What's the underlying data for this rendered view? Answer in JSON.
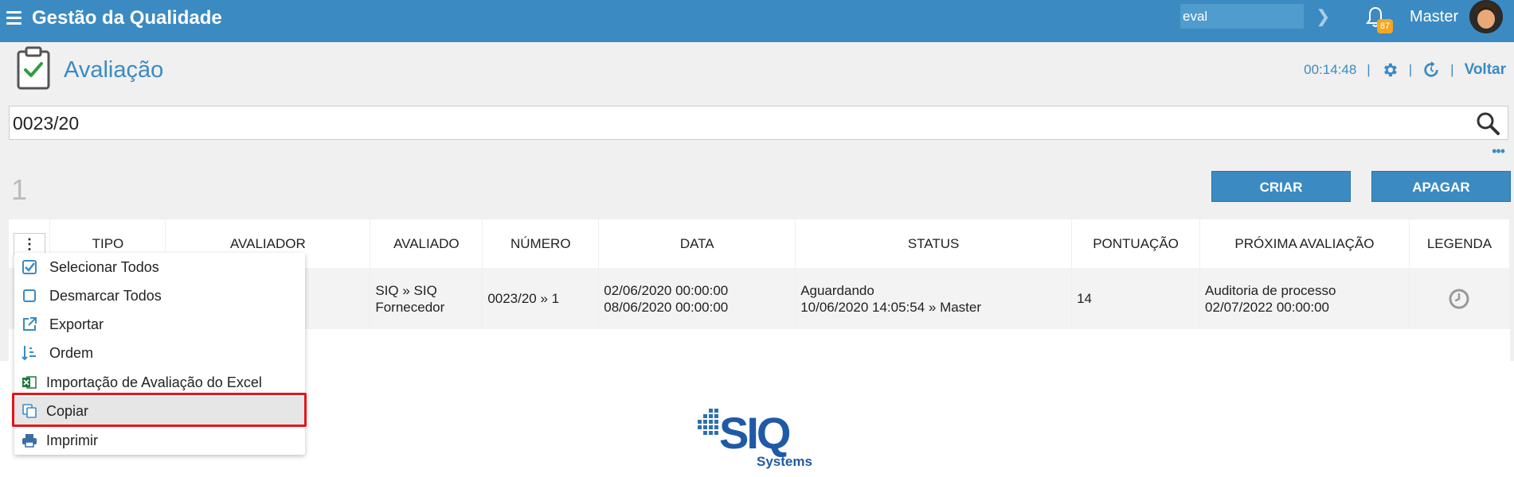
{
  "topbar": {
    "app_title": "Gestão da Qualidade",
    "search_value": "eval",
    "notification_count": "87",
    "user_name": "Master"
  },
  "header": {
    "title": "Avaliação",
    "timer": "00:14:48",
    "back_label": "Voltar"
  },
  "search": {
    "value": "0023/20"
  },
  "result_count": "1",
  "actions": {
    "create_label": "CRIAR",
    "delete_label": "APAGAR"
  },
  "table": {
    "columns": [
      "TIPO",
      "AVALIADOR",
      "AVALIADO",
      "NÚMERO",
      "DATA",
      "STATUS",
      "PONTUAÇÃO",
      "PRÓXIMA AVALIAÇÃO",
      "LEGENDA"
    ],
    "row": {
      "avaliado_line1": "SIQ » SIQ",
      "avaliado_line2": "Fornecedor",
      "numero": "0023/20 » 1",
      "data_line1": "02/06/2020 00:00:00",
      "data_line2": "08/06/2020 00:00:00",
      "status_line1": "Aguardando",
      "status_line2": "10/06/2020 14:05:54 » Master",
      "pontuacao": "14",
      "proxima_line1": "Auditoria de processo",
      "proxima_line2": "02/07/2022 00:00:00"
    }
  },
  "menu": {
    "items": [
      {
        "label": "Selecionar Todos",
        "icon": "checked-checkbox-icon"
      },
      {
        "label": "Desmarcar Todos",
        "icon": "empty-checkbox-icon"
      },
      {
        "label": "Exportar",
        "icon": "external-link-icon"
      },
      {
        "label": "Ordem",
        "icon": "sort-order-icon"
      },
      {
        "label": "Importação de Avaliação do Excel",
        "icon": "excel-icon"
      },
      {
        "label": "Copiar",
        "icon": "copy-icon"
      },
      {
        "label": "Imprimir",
        "icon": "printer-icon"
      }
    ]
  },
  "colors": {
    "primary": "#3b8bc2",
    "highlight_border": "#e8141a",
    "badge": "#f5a623"
  }
}
